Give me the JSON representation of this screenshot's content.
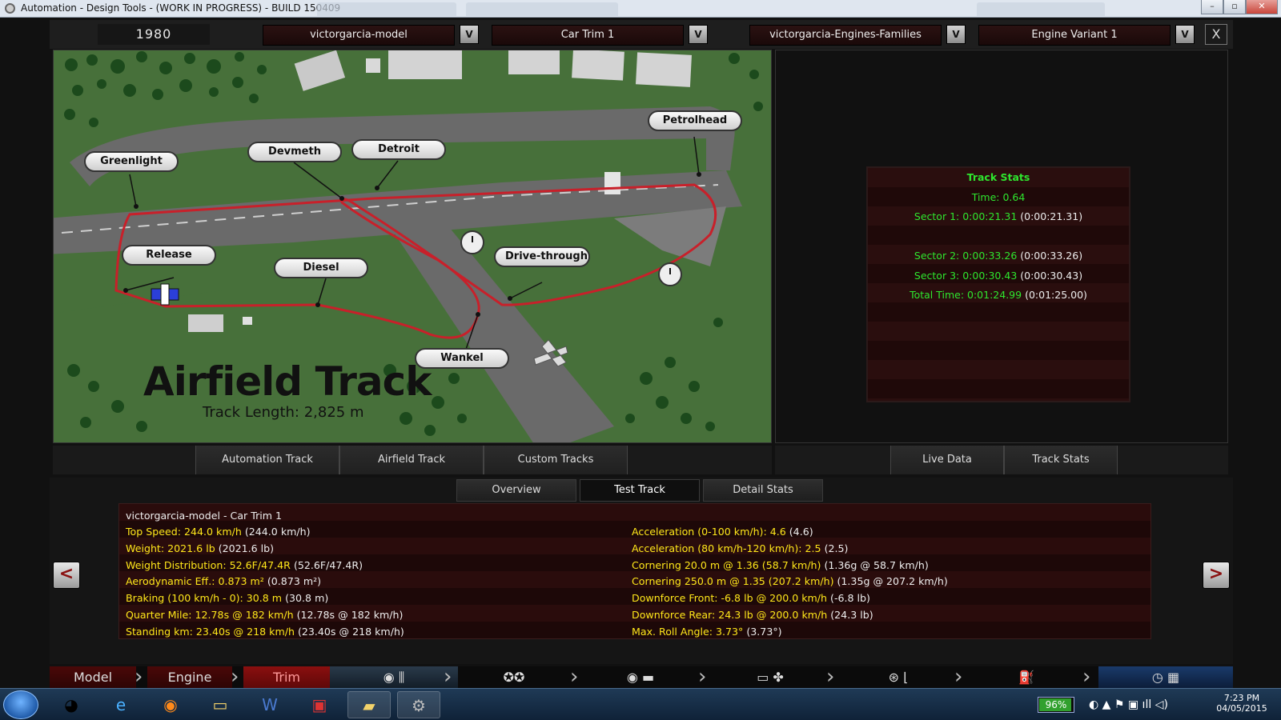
{
  "window": {
    "title": "Automation - Design Tools - (WORK IN PROGRESS) - BUILD 150409"
  },
  "header": {
    "year": "1980",
    "model": "victorgarcia-model",
    "trim": "Car Trim 1",
    "engine_family": "victorgarcia-Engines-Families",
    "engine_variant": "Engine Variant 1",
    "dropdown_glyph": "V",
    "close_glyph": "X"
  },
  "map": {
    "title": "Airfield Track",
    "length": "Track Length: 2,825 m",
    "markers": {
      "greenlight": "Greenlight",
      "devmeth": "Devmeth",
      "detroit": "Detroit",
      "petrolhead": "Petrolhead",
      "release": "Release",
      "diesel": "Diesel",
      "drivethrough": "Drive-through",
      "wankel": "Wankel"
    }
  },
  "track_tabs": [
    "Automation Track",
    "Airfield Track",
    "Custom Tracks"
  ],
  "right_tabs": [
    "Live Data",
    "Track Stats"
  ],
  "track_stats": {
    "heading": "Track Stats",
    "time": "Time: 0.64",
    "sector1": "Sector 1: 0:00:21.31",
    "sector1_ref": "(0:00:21.31)",
    "sector2": "Sector 2: 0:00:33.26",
    "sector2_ref": "(0:00:33.26)",
    "sector3": "Sector 3: 0:00:30.43",
    "sector3_ref": "(0:00:30.43)",
    "total": "Total Time: 0:01:24.99",
    "total_ref": "(0:01:25.00)"
  },
  "bottom_tabs": {
    "overview": "Overview",
    "test_track": "Test Track",
    "detail_stats": "Detail Stats",
    "active": "Test Track"
  },
  "info": {
    "caption": "victorgarcia-model - Car Trim 1",
    "left": [
      {
        "label": "Top Speed: 244.0 km/h",
        "ref": "(244.0 km/h)"
      },
      {
        "label": "Weight: 2021.6 lb",
        "ref": "(2021.6 lb)"
      },
      {
        "label": "Weight Distribution: 52.6F/47.4R",
        "ref": "(52.6F/47.4R)"
      },
      {
        "label": "Aerodynamic Eff.: 0.873 m²",
        "ref": "(0.873 m²)"
      },
      {
        "label": "Braking (100 km/h - 0): 30.8 m",
        "ref": "(30.8 m)"
      },
      {
        "label": "Quarter Mile: 12.78s @ 182 km/h",
        "ref": "(12.78s @ 182 km/h)"
      },
      {
        "label": "Standing km: 23.40s @ 218 km/h",
        "ref": "(23.40s @ 218 km/h)"
      }
    ],
    "right": [
      {
        "label": "Acceleration (0-100 km/h): 4.6",
        "ref": "(4.6)"
      },
      {
        "label": "Acceleration (80 km/h-120 km/h): 2.5",
        "ref": "(2.5)"
      },
      {
        "label": "Cornering 20.0 m @ 1.36 (58.7 km/h)",
        "ref": "(1.36g @ 58.7 km/h)"
      },
      {
        "label": "Cornering 250.0 m @ 1.35 (207.2 km/h)",
        "ref": "(1.35g @ 207.2 km/h)"
      },
      {
        "label": "Downforce Front: -6.8 lb @ 200.0 km/h",
        "ref": "(-6.8 lb)"
      },
      {
        "label": "Downforce Rear: 24.3 lb @ 200.0 km/h",
        "ref": "(24.3 lb)"
      },
      {
        "label": "Max. Roll Angle: 3.73°",
        "ref": "(3.73°)"
      }
    ],
    "prev_glyph": "<",
    "next_glyph": ">"
  },
  "nav": {
    "model": "Model",
    "engine": "Engine",
    "trim": "Trim",
    "icons": [
      "wheel-suspension-icon",
      "tyres-icon",
      "brakes-body-icon",
      "car-aero-icon",
      "steering-seat-icon",
      "fuel-icon",
      "speedometer-checkered-flag-icon"
    ]
  },
  "taskbar": {
    "battery": "96%",
    "time": "7:23 PM",
    "date": "04/05/2015",
    "apps": [
      "chrome-icon",
      "internet-explorer-icon",
      "firefox-icon",
      "file-explorer-icon",
      "word-icon",
      "app-icon",
      "folder-icon",
      "automation-icon"
    ]
  },
  "colors": {
    "stat_green": "#2ee62e",
    "info_yellow": "#ffe71a",
    "nav_red": "#8a0f0f",
    "track_red": "#c8202a"
  }
}
